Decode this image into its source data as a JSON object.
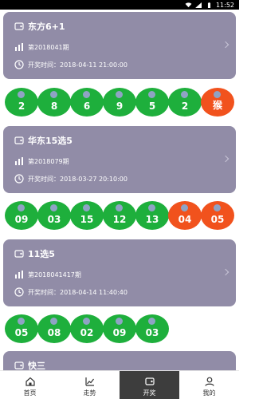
{
  "status_bar": {
    "time": "11:52",
    "icons": [
      "wifi-icon",
      "signal-icon",
      "battery-icon"
    ]
  },
  "colors": {
    "card_bg": "#918ca7",
    "ball_green": "#1eaf3c",
    "ball_red": "#f1521d",
    "tab_active_bg": "#3d3d3d"
  },
  "lotteries": [
    {
      "name": "东方6+1",
      "issue": "第2018041期",
      "draw_time": "开奖时间：2018-04-11 21:00:00",
      "balls": [
        {
          "value": "2",
          "color": "green"
        },
        {
          "value": "8",
          "color": "green"
        },
        {
          "value": "6",
          "color": "green"
        },
        {
          "value": "9",
          "color": "green"
        },
        {
          "value": "5",
          "color": "green"
        },
        {
          "value": "2",
          "color": "green"
        },
        {
          "value": "猴",
          "color": "red"
        }
      ]
    },
    {
      "name": "华东15选5",
      "issue": "第2018079期",
      "draw_time": "开奖时间：2018-03-27 20:10:00",
      "balls": [
        {
          "value": "09",
          "color": "green"
        },
        {
          "value": "03",
          "color": "green"
        },
        {
          "value": "15",
          "color": "green"
        },
        {
          "value": "12",
          "color": "green"
        },
        {
          "value": "13",
          "color": "green"
        },
        {
          "value": "04",
          "color": "red"
        },
        {
          "value": "05",
          "color": "red"
        }
      ]
    },
    {
      "name": "11选5",
      "issue": "第2018041417期",
      "draw_time": "开奖时间：2018-04-14 11:40:40",
      "balls": [
        {
          "value": "05",
          "color": "green"
        },
        {
          "value": "08",
          "color": "green"
        },
        {
          "value": "02",
          "color": "green"
        },
        {
          "value": "09",
          "color": "green"
        },
        {
          "value": "03",
          "color": "green"
        }
      ]
    },
    {
      "name": "快三",
      "issue": "",
      "draw_time": "",
      "balls": []
    }
  ],
  "tabs": [
    {
      "label": "首页",
      "icon": "home-icon",
      "active": false
    },
    {
      "label": "走势",
      "icon": "trend-chart-icon",
      "active": false
    },
    {
      "label": "开奖",
      "icon": "lottery-ticket-icon",
      "active": true
    },
    {
      "label": "我的",
      "icon": "user-icon",
      "active": false
    }
  ]
}
